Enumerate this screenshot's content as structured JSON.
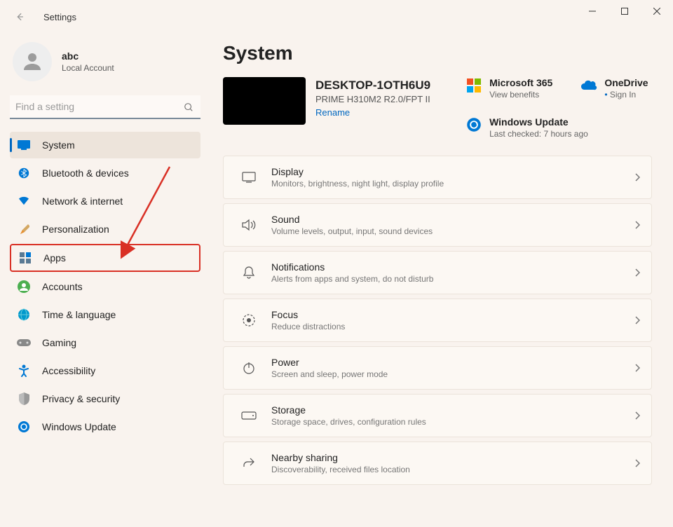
{
  "window": {
    "title": "Settings"
  },
  "user": {
    "name": "abc",
    "type": "Local Account"
  },
  "search": {
    "placeholder": "Find a setting"
  },
  "sidebar": {
    "items": [
      {
        "label": "System"
      },
      {
        "label": "Bluetooth & devices"
      },
      {
        "label": "Network & internet"
      },
      {
        "label": "Personalization"
      },
      {
        "label": "Apps"
      },
      {
        "label": "Accounts"
      },
      {
        "label": "Time & language"
      },
      {
        "label": "Gaming"
      },
      {
        "label": "Accessibility"
      },
      {
        "label": "Privacy & security"
      },
      {
        "label": "Windows Update"
      }
    ]
  },
  "page": {
    "title": "System"
  },
  "device": {
    "name": "DESKTOP-1OTH6U9",
    "model": "PRIME H310M2 R2.0/FPT II",
    "rename": "Rename"
  },
  "info": {
    "ms365": {
      "title": "Microsoft 365",
      "sub": "View benefits"
    },
    "onedrive": {
      "title": "OneDrive",
      "sub": "Sign In",
      "bullet": "•"
    },
    "wu": {
      "title": "Windows Update",
      "sub": "Last checked: 7 hours ago"
    }
  },
  "cards": [
    {
      "title": "Display",
      "sub": "Monitors, brightness, night light, display profile"
    },
    {
      "title": "Sound",
      "sub": "Volume levels, output, input, sound devices"
    },
    {
      "title": "Notifications",
      "sub": "Alerts from apps and system, do not disturb"
    },
    {
      "title": "Focus",
      "sub": "Reduce distractions"
    },
    {
      "title": "Power",
      "sub": "Screen and sleep, power mode"
    },
    {
      "title": "Storage",
      "sub": "Storage space, drives, configuration rules"
    },
    {
      "title": "Nearby sharing",
      "sub": "Discoverability, received files location"
    }
  ]
}
